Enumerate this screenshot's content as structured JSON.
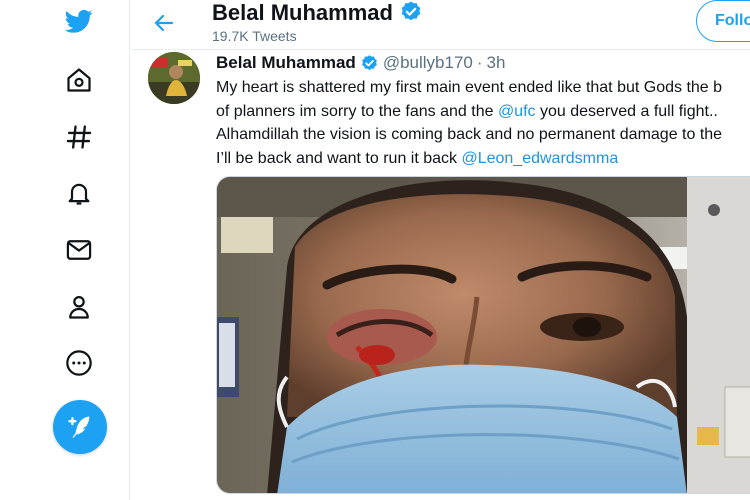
{
  "header": {
    "name": "Belal Muhammad",
    "tweet_count": "19.7K Tweets",
    "follow_label": "Follo"
  },
  "tweet": {
    "name": "Belal Muhammad",
    "handle": "@bullyb170",
    "separator": "·",
    "time": "3h",
    "lines": [
      {
        "before": "My heart is shattered my first main event ended like that but Gods the b",
        "mention": "",
        "after": ""
      },
      {
        "before": "of planners im sorry to the fans and the ",
        "mention": "@ufc",
        "after": " you deserved a full fight.."
      },
      {
        "before": "Alhamdillah the vision is coming back and no permanent damage to the",
        "mention": "",
        "after": ""
      },
      {
        "before": "I’ll be back and want to run it back ",
        "mention": "@Leon_edwardsmma",
        "after": ""
      }
    ]
  },
  "nav": {
    "items": [
      {
        "icon": "twitter-logo-icon"
      },
      {
        "icon": "home-icon"
      },
      {
        "icon": "hashtag-icon"
      },
      {
        "icon": "bell-icon"
      },
      {
        "icon": "mail-icon"
      },
      {
        "icon": "profile-icon"
      },
      {
        "icon": "more-icon"
      }
    ]
  },
  "colors": {
    "accent": "#1da1f2",
    "mention": "#1b95e0",
    "muted": "#5b7083",
    "border": "#e6ecf0"
  }
}
